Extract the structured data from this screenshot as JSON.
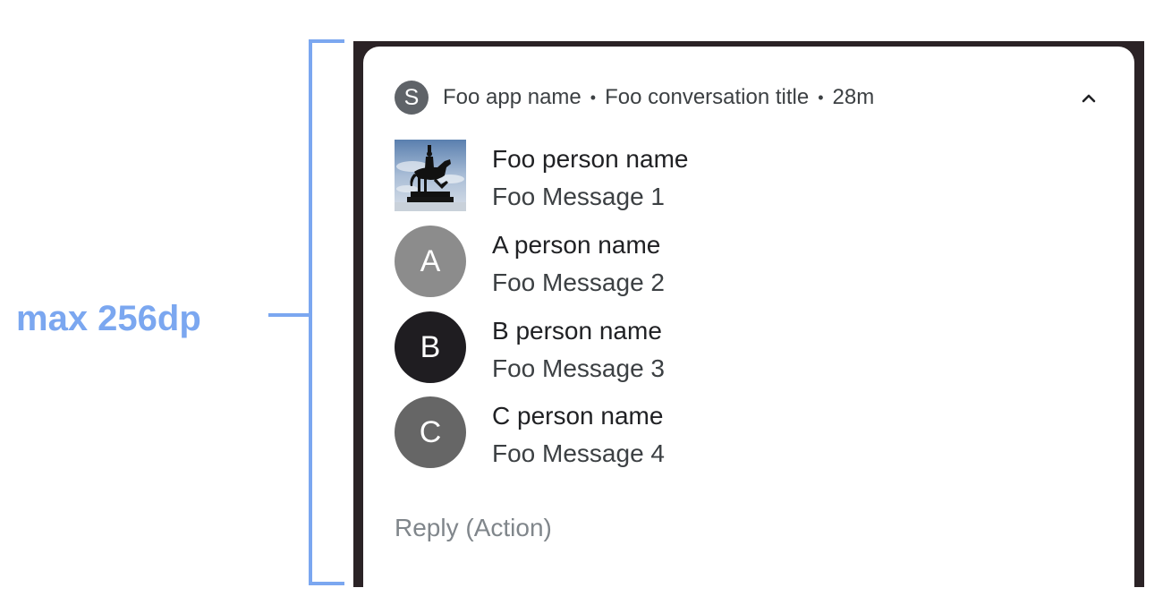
{
  "annotation": {
    "label": "max 256dp",
    "color": "#7ba7f0"
  },
  "notification": {
    "app_badge_letter": "S",
    "app_name": "Foo app name",
    "separator": "•",
    "conversation_title": "Foo conversation title",
    "time": "28m",
    "expand_icon": "chevron-up-icon",
    "messages": [
      {
        "sender": "Foo person name",
        "text": "Foo Message 1",
        "avatar_type": "photo",
        "avatar_icon": "statue-photo",
        "avatar_color": "#8ea9c8"
      },
      {
        "sender": "A person name",
        "text": "Foo Message 2",
        "avatar_type": "letter",
        "avatar_letter": "A",
        "avatar_color": "#8c8c8c"
      },
      {
        "sender": "B person name",
        "text": "Foo Message 3",
        "avatar_type": "letter",
        "avatar_letter": "B",
        "avatar_color": "#1f1d21"
      },
      {
        "sender": "C person name",
        "text": "Foo Message 4",
        "avatar_type": "letter",
        "avatar_letter": "C",
        "avatar_color": "#666666"
      }
    ],
    "action_label": "Reply (Action)"
  }
}
